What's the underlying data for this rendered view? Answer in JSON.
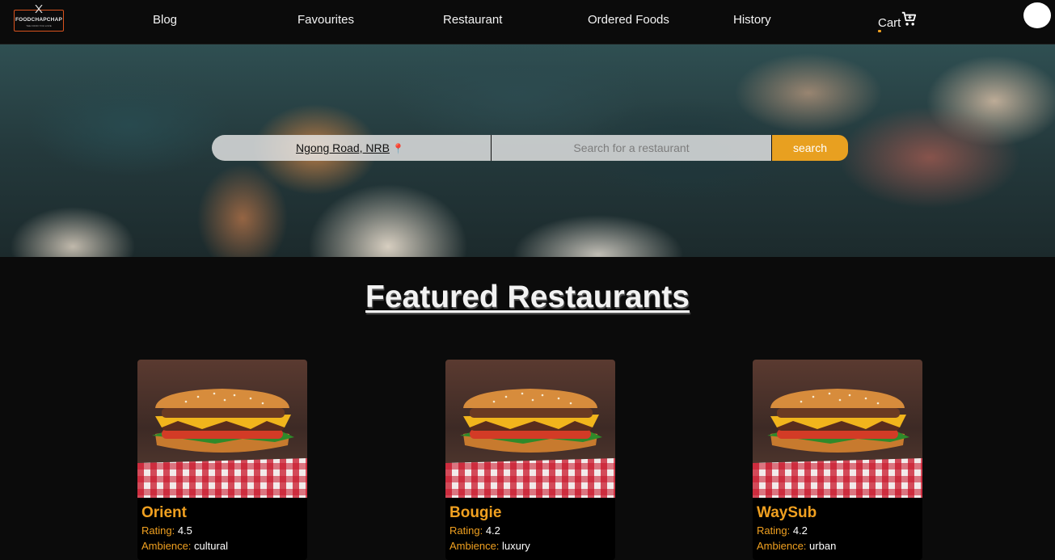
{
  "brand": {
    "name": "FOODCHAPCHAP",
    "tagline": "THE FOOD YOU LOVE"
  },
  "nav": {
    "items": [
      "Blog",
      "Favourites",
      "Restaurant",
      "Ordered Foods",
      "History"
    ],
    "cart_label": "Cart"
  },
  "search": {
    "location": "Ngong Road, NRB",
    "placeholder": "Search for a restaurant",
    "button_label": "search"
  },
  "featured": {
    "title": "Featured Restaurants",
    "rating_label": "Rating:",
    "ambience_label": "Ambience:",
    "restaurants": [
      {
        "name": "Orient",
        "rating": "4.5",
        "ambience": "cultural"
      },
      {
        "name": "Bougie",
        "rating": "4.2",
        "ambience": "luxury"
      },
      {
        "name": "WaySub",
        "rating": "4.2",
        "ambience": "urban"
      }
    ]
  },
  "colors": {
    "accent": "#f0a020",
    "background": "#0b0b0b",
    "logo_border": "#d9531e"
  },
  "icons": {
    "cart": "cart-icon",
    "location": "map-pin-icon",
    "utensils": "utensils-icon"
  }
}
